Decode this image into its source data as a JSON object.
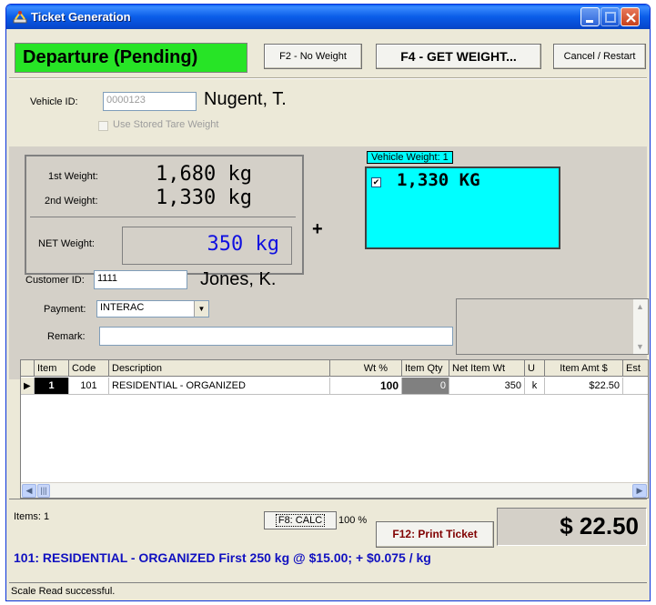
{
  "window": {
    "title": "Ticket Generation",
    "accent": "#0a5ef0",
    "icons": [
      "scale-app-icon",
      "minimize-icon",
      "maximize-icon",
      "close-icon"
    ]
  },
  "toolbar": {
    "status": "Departure (Pending)",
    "status_color": "#27e426",
    "no_weight_label": "F2 - No Weight",
    "get_weight_label": "F4 - GET WEIGHT...",
    "cancel_label": "Cancel / Restart"
  },
  "vehicle": {
    "id_label": "Vehicle ID:",
    "id_value": "0000123",
    "owner": "Nugent, T.",
    "stored_tare_label": "Use Stored Tare Weight"
  },
  "weights": {
    "first_label": "1st Weight:",
    "first_value": "1,680  kg",
    "second_label": "2nd Weight:",
    "second_value": "1,330  kg",
    "net_label": "NET Weight:",
    "net_value": "350  kg",
    "net_color": "#1010e0",
    "plus": "+"
  },
  "vehicle_weight": {
    "caption": "Vehicle Weight:  1",
    "value": "1,330  KG",
    "checked": true,
    "color": "#00ffff"
  },
  "customer": {
    "id_label": "Customer ID:",
    "id_value": "1111",
    "name": "Jones, K.",
    "payment_label": "Payment:",
    "payment_value": "INTERAC",
    "remark_label": "Remark:",
    "remark_value": ""
  },
  "grid": {
    "columns": [
      "Item",
      "Code",
      "Description",
      "Wt %",
      "Item Qty",
      "Net Item Wt",
      "U",
      "Item Amt $",
      "Est"
    ],
    "rows": [
      {
        "item": "1",
        "code": "101",
        "description": "RESIDENTIAL - ORGANIZED",
        "wt_pct": "100",
        "qty": "0",
        "net_wt": "350",
        "unit": "k",
        "amount": "$22.50",
        "est": ""
      }
    ]
  },
  "footer": {
    "items_label": "Items: 1",
    "calc_label": "F8: CALC",
    "calc_pct": "100 %",
    "print_label": "F12: Print Ticket",
    "total": "$ 22.50",
    "pricing": "101: RESIDENTIAL - ORGANIZED   First 250 kg @ $15.00; + $0.075 / kg",
    "pricing_color": "#1010c0"
  },
  "statusbar": {
    "message": "Scale Read successful."
  }
}
